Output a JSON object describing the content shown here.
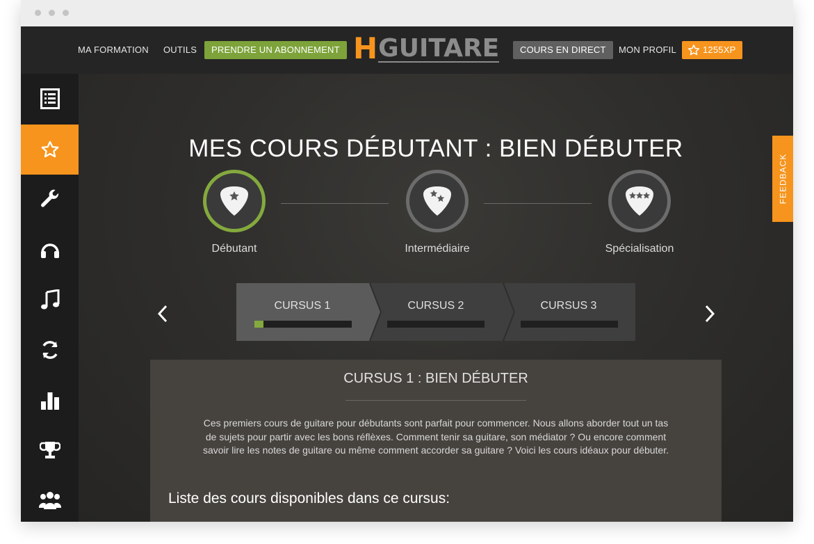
{
  "nav": {
    "ma_formation": "MA FORMATION",
    "outils": "OUTILS",
    "abonnement": "PRENDRE UN ABONNEMENT",
    "logo_h": "H",
    "logo_rest": "GUITARE",
    "cours_direct": "COURS EN DIRECT",
    "mon_profil": "MON PROFIL",
    "xp": "1255XP"
  },
  "sidebar": {
    "items": [
      {
        "icon": "list-icon",
        "active": false
      },
      {
        "icon": "star-icon",
        "active": true
      },
      {
        "icon": "wrench-icon",
        "active": false
      },
      {
        "icon": "headphones-icon",
        "active": false
      },
      {
        "icon": "music-note-icon",
        "active": false
      },
      {
        "icon": "refresh-icon",
        "active": false
      },
      {
        "icon": "bar-chart-icon",
        "active": false
      },
      {
        "icon": "trophy-icon",
        "active": false
      },
      {
        "icon": "users-icon",
        "active": false
      }
    ]
  },
  "main": {
    "title": "MES COURS DÉBUTANT : BIEN DÉBUTER",
    "levels": [
      {
        "label": "Débutant",
        "stars": 1,
        "active": true
      },
      {
        "label": "Intermédiaire",
        "stars": 2,
        "active": false
      },
      {
        "label": "Spécialisation",
        "stars": 3,
        "active": false
      }
    ],
    "cursus": [
      {
        "label": "CURSUS 1",
        "progress": 0.09
      },
      {
        "label": "CURSUS 2",
        "progress": 0
      },
      {
        "label": "CURSUS 3",
        "progress": 0
      }
    ],
    "panel": {
      "title": "CURSUS 1 : BIEN DÉBUTER",
      "description_lines": [
        "Ces premiers cours de guitare pour débutants sont parfait pour commencer. Nous allons aborder tout un tas",
        "de sujets pour partir avec les bons réflèxes. Comment tenir sa guitare, son médiator ? Ou encore comment",
        "savoir lire les notes de guitare ou même comment accorder sa guitare ? Voici les cours idéaux pour débuter."
      ],
      "subtitle": "Liste des cours disponibles dans ce cursus:"
    },
    "feedback": "FEEDBACK"
  },
  "colors": {
    "accent": "#f7941d",
    "green": "#84a93e",
    "grey_button": "#606060"
  }
}
